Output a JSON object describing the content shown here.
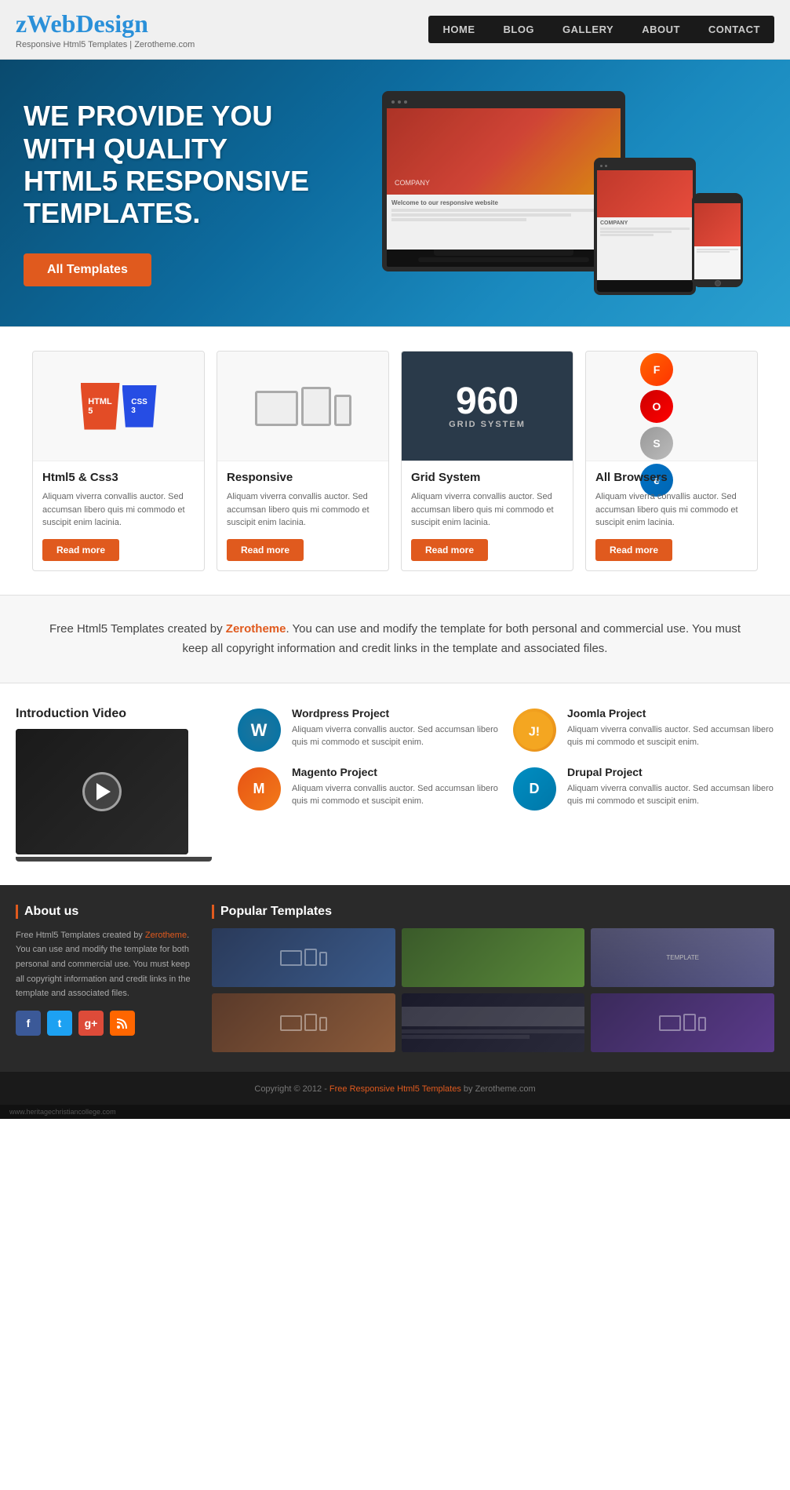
{
  "site": {
    "logo_z": "z",
    "logo_rest": "WebDesign",
    "logo_sub": "Responsive Html5 Templates | Zerotheme.com",
    "url": "www.heritagechristiancollege.com"
  },
  "nav": {
    "items": [
      "HOME",
      "BLOG",
      "GALLERY",
      "ABOUT",
      "CONTACT"
    ]
  },
  "hero": {
    "title": "WE PROVIDE YOU WITH QUALITY HTML5 RESPONSIVE TEMPLATES.",
    "cta": "All Templates"
  },
  "features": [
    {
      "title": "Html5 & Css3",
      "desc": "Aliquam viverra convallis auctor. Sed accumsan libero quis mi commodo et suscipit enim lacinia.",
      "btn": "Read more"
    },
    {
      "title": "Responsive",
      "desc": "Aliquam viverra convallis auctor. Sed accumsan libero quis mi commodo et suscipit enim lacinia.",
      "btn": "Read more"
    },
    {
      "title": "Grid System",
      "desc": "Aliquam viverra convallis auctor. Sed accumsan libero quis mi commodo et suscipit enim lacinia.",
      "btn": "Read more"
    },
    {
      "title": "All Browsers",
      "desc": "Aliquam viverra convallis auctor. Sed accumsan libero quis mi commodo et suscipit enim lacinia.",
      "btn": "Read more"
    }
  ],
  "info_banner": {
    "text_before": "Free Html5 Templates created by ",
    "link_text": "Zerotheme",
    "text_after": ". You can use and modify the template for both personal and commercial use. You must keep all copyright information and credit links in the template and associated files."
  },
  "video_section": {
    "title": "Introduction Video"
  },
  "projects": [
    {
      "title": "Wordpress Project",
      "desc": "Aliquam viverra convallis auctor. Sed accumsan libero quis mi commodo et suscipit enim."
    },
    {
      "title": "Joomla Project",
      "desc": "Aliquam viverra convallis auctor. Sed accumsan libero quis mi commodo et suscipit enim."
    },
    {
      "title": "Magento Project",
      "desc": "Aliquam viverra convallis auctor. Sed accumsan libero quis mi commodo et suscipit enim."
    },
    {
      "title": "Drupal Project",
      "desc": "Aliquam viverra convallis auctor. Sed accumsan libero quis mi commodo et suscipit enim."
    }
  ],
  "footer": {
    "about_title": "About us",
    "about_text": "Free Html5 Templates created by ",
    "about_link": "Zerotheme",
    "about_text2": ". You can use and modify the template for both personal and commercial use. You must keep all copyright information and credit links in the template and associated files.",
    "templates_title": "Popular Templates",
    "social": [
      "f",
      "t",
      "g+",
      "rss"
    ]
  },
  "copyright": {
    "prefix": "Copyright © 2012 - ",
    "link_text": "Free Responsive Html5 Templates",
    "suffix": " by Zerotheme.com"
  }
}
